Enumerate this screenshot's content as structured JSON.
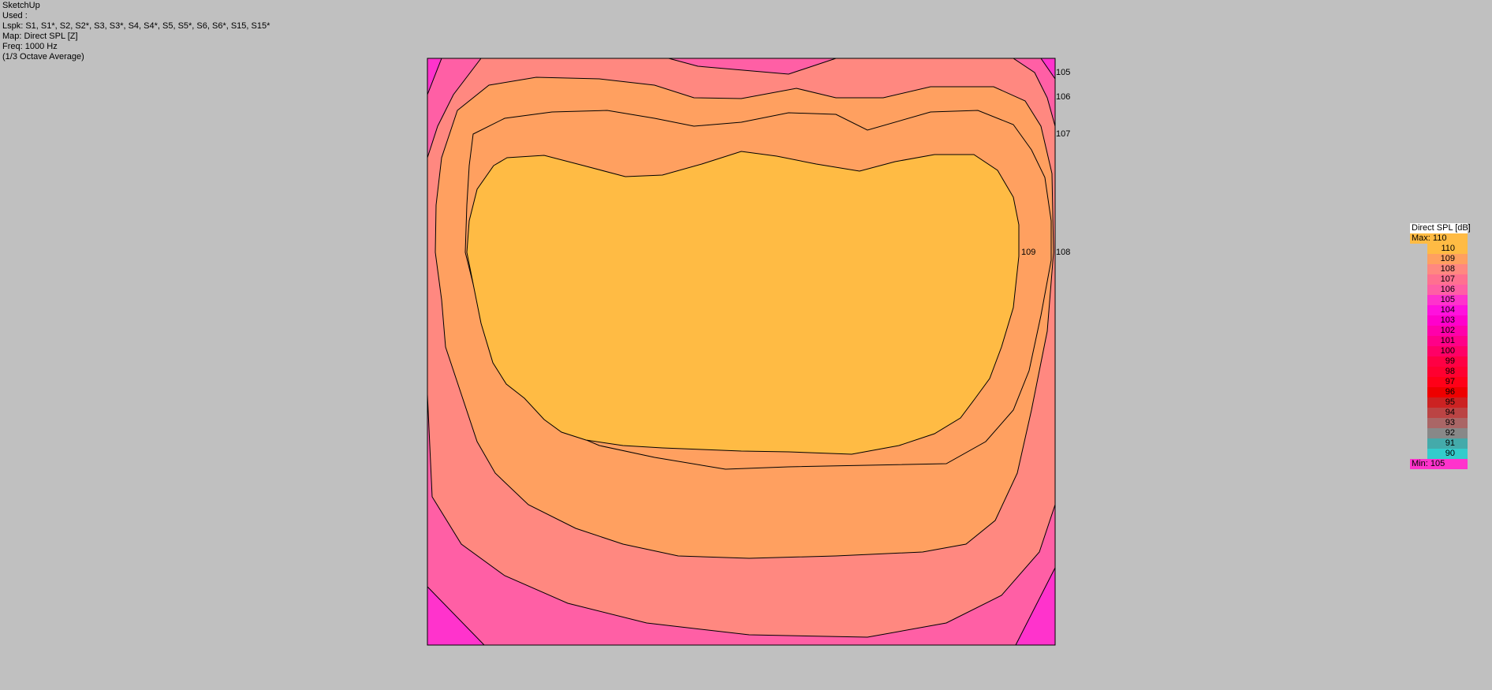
{
  "header": {
    "app": "SketchUp",
    "used": "Used :",
    "loudspeakers": "Lspk: S1, S1*, S2, S2*, S3, S3*, S4, S4*, S5, S5*, S6, S6*, S15, S15*",
    "map": "Map: Direct SPL [Z]",
    "freq": "Freq: 1000 Hz",
    "averaging": "(1/3 Octave Average)"
  },
  "contour_labels": [
    "105",
    "106",
    "107",
    "108",
    "109"
  ],
  "legend": {
    "title": "Direct SPL [dB]",
    "max_label": "Max:",
    "max_value": "110",
    "min_label": "Min:",
    "min_value": "105",
    "max_color": "#ffbb44",
    "min_color": "#ff33cc",
    "levels": [
      {
        "value": "110",
        "color": "#ffbb44"
      },
      {
        "value": "109",
        "color": "#ffa060"
      },
      {
        "value": "108",
        "color": "#ff8880"
      },
      {
        "value": "107",
        "color": "#ff7090"
      },
      {
        "value": "106",
        "color": "#ff5fa5"
      },
      {
        "value": "105",
        "color": "#ff33cc"
      },
      {
        "value": "104",
        "color": "#ff11dd"
      },
      {
        "value": "103",
        "color": "#ff00cc"
      },
      {
        "value": "102",
        "color": "#ff00aa"
      },
      {
        "value": "101",
        "color": "#ff0088"
      },
      {
        "value": "100",
        "color": "#ff0066"
      },
      {
        "value": "99",
        "color": "#ff0044"
      },
      {
        "value": "98",
        "color": "#ff0030"
      },
      {
        "value": "97",
        "color": "#ff0018"
      },
      {
        "value": "96",
        "color": "#ee0000"
      },
      {
        "value": "95",
        "color": "#cc2222"
      },
      {
        "value": "94",
        "color": "#bb4444"
      },
      {
        "value": "93",
        "color": "#aa6666"
      },
      {
        "value": "92",
        "color": "#888888"
      },
      {
        "value": "91",
        "color": "#44aaaa"
      },
      {
        "value": "90",
        "color": "#33cccc"
      }
    ]
  }
}
